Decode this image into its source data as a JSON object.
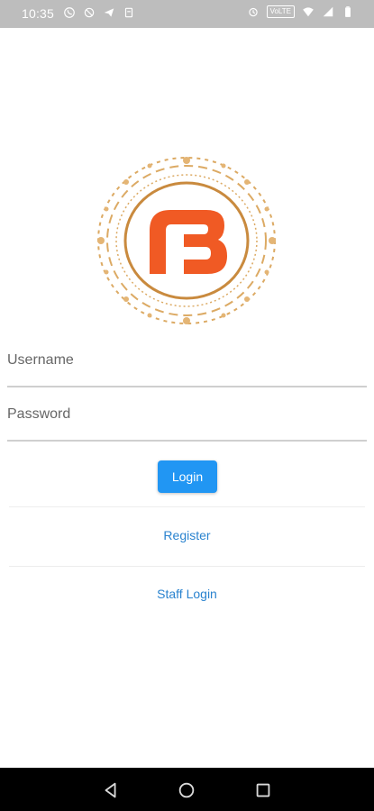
{
  "status_bar": {
    "time": "10:35",
    "left_icons": [
      "whatsapp-icon",
      "sync-disabled-icon",
      "telegram-icon",
      "clipboard-icon"
    ],
    "right_icons": [
      "alarm-icon",
      "volte-icon",
      "wifi-icon",
      "signal-icon",
      "battery-icon"
    ],
    "volte_label": "VoLTE"
  },
  "logo": {
    "letter": "B",
    "brand_color": "#f05a24",
    "ring_color": "#d9a45a"
  },
  "form": {
    "username": {
      "placeholder": "Username",
      "value": ""
    },
    "password": {
      "placeholder": "Password",
      "value": ""
    },
    "login_label": "Login"
  },
  "links": {
    "register": "Register",
    "staff_login": "Staff Login"
  },
  "nav": {
    "icons": [
      "back-icon",
      "home-icon",
      "recent-apps-icon"
    ]
  },
  "colors": {
    "accent": "#2196f3",
    "link": "#2a83cf",
    "status_bar": "#bdbdbd",
    "nav_bar": "#000000"
  }
}
